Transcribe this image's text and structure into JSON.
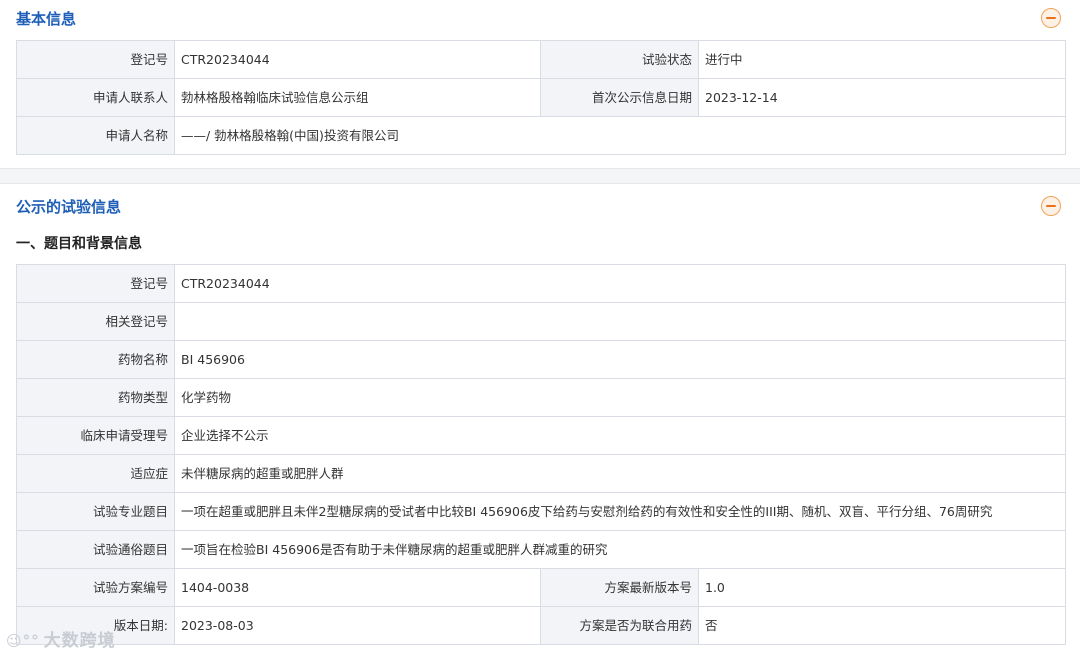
{
  "basic_info": {
    "title": "基本信息",
    "rows": [
      {
        "label": "登记号",
        "value": "CTR20234044",
        "label2": "试验状态",
        "value2": "进行中"
      },
      {
        "label": "申请人联系人",
        "value": "勃林格殷格翰临床试验信息公示组",
        "label2": "首次公示信息日期",
        "value2": "2023-12-14"
      },
      {
        "label": "申请人名称",
        "value": "——/ 勃林格殷格翰(中国)投资有限公司"
      }
    ]
  },
  "trial_info": {
    "title": "公示的试验信息",
    "subtitle": "一、题目和背景信息",
    "rows": [
      {
        "label": "登记号",
        "value": "CTR20234044"
      },
      {
        "label": "相关登记号",
        "value": ""
      },
      {
        "label": "药物名称",
        "value": "BI 456906"
      },
      {
        "label": "药物类型",
        "value": "化学药物"
      },
      {
        "label": "临床申请受理号",
        "value": "企业选择不公示"
      },
      {
        "label": "适应症",
        "value": "未伴糖尿病的超重或肥胖人群"
      },
      {
        "label": "试验专业题目",
        "value": "一项在超重或肥胖且未伴2型糖尿病的受试者中比较BI 456906皮下给药与安慰剂给药的有效性和安全性的III期、随机、双盲、平行分组、76周研究"
      },
      {
        "label": "试验通俗题目",
        "value": "一项旨在检验BI 456906是否有助于未伴糖尿病的超重或肥胖人群减重的研究"
      },
      {
        "label": "试验方案编号",
        "value": "1404-0038",
        "label2": "方案最新版本号",
        "value2": "1.0"
      },
      {
        "label": "版本日期:",
        "value": "2023-08-03",
        "label2": "方案是否为联合用药",
        "value2": "否"
      }
    ]
  },
  "watermark": {
    "logo": "☺°°",
    "text": "大数跨境"
  },
  "colors": {
    "accent": "#1f5fb8",
    "label_bg": "#f2f4f7",
    "collapse": "#e8731a"
  }
}
